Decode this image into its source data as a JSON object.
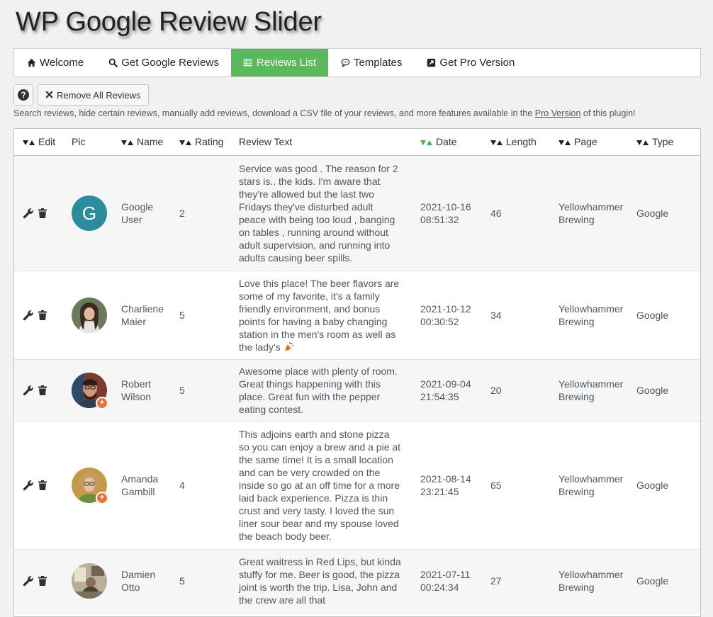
{
  "page": {
    "title": "WP Google Review Slider"
  },
  "tabs": [
    {
      "label": "Welcome",
      "icon": "home-icon",
      "active": false
    },
    {
      "label": "Get Google Reviews",
      "icon": "search-icon",
      "active": false
    },
    {
      "label": "Reviews List",
      "icon": "list-icon",
      "active": true
    },
    {
      "label": "Templates",
      "icon": "comment-icon",
      "active": false
    },
    {
      "label": "Get Pro Version",
      "icon": "external-link-icon",
      "active": false
    }
  ],
  "toolbar": {
    "help_label": "?",
    "remove_all_label": "Remove All Reviews"
  },
  "description": {
    "before": "Search reviews, hide certain reviews, manually add reviews, download a CSV file of your reviews, and more features available in the ",
    "link": "Pro Version",
    "after": " of this plugin!"
  },
  "table": {
    "columns": [
      "Edit",
      "Pic",
      "Name",
      "Rating",
      "Review Text",
      "Date",
      "Length",
      "Page",
      "Type"
    ],
    "rows": [
      {
        "name_line1": "Google",
        "name_line2": "User",
        "avatar": "letter",
        "avatar_letter": "G",
        "rating": "2",
        "text": "Service was good . The reason for 2 stars is.. the kids. I'm aware that they're allowed but the last two Fridays they've disturbed adult peace with being too loud , banging on tables , running around without adult supervision, and running into adults causing beer spills.",
        "date_line1": "2021-10-16",
        "date_line2": "08:51:32",
        "length": "46",
        "page_line1": "Yellowhammer",
        "page_line2": "Brewing",
        "type": "Google"
      },
      {
        "name_line1": "Charliene",
        "name_line2": "Maier",
        "avatar": "photo-woman-dark-hair",
        "rating": "5",
        "text": "Love this place! The beer flavors are some of my favorite, it's a family friendly environment, and bonus points for having a baby changing station in the men's room as well as the lady's",
        "date_line1": "2021-10-12",
        "date_line2": "00:30:52",
        "length": "34",
        "page_line1": "Yellowhammer",
        "page_line2": "Brewing",
        "type": "Google"
      },
      {
        "name_line1": "Robert",
        "name_line2": "Wilson",
        "avatar": "photo-man-beard",
        "rating": "5",
        "text": "Awesome place with plenty of room. Great things happening with this place. Great fun with the pepper eating contest.",
        "date_line1": "2021-09-04",
        "date_line2": "21:54:35",
        "length": "20",
        "page_line1": "Yellowhammer",
        "page_line2": "Brewing",
        "type": "Google"
      },
      {
        "name_line1": "Amanda",
        "name_line2": "Gambill",
        "avatar": "photo-woman-blonde",
        "rating": "4",
        "text": "This adjoins earth and stone pizza so you can enjoy a brew and a pie at the same time! It is a small location and can be very crowded on the inside so go at an off time for a more laid back experience. Pizza is thin crust and very tasty. I loved the sun liner sour bear and my spouse loved the beach body beer.",
        "date_line1": "2021-08-14",
        "date_line2": "23:21:45",
        "length": "65",
        "page_line1": "Yellowhammer",
        "page_line2": "Brewing",
        "type": "Google"
      },
      {
        "name_line1": "Damien",
        "name_line2": "Otto",
        "avatar": "photo-interior",
        "rating": "5",
        "text": "Great waitress in Red Lips, but kinda stuffy for me. Beer is good, the pizza joint is worth the trip. Lisa, John and the crew are all that",
        "date_line1": "2021-07-11",
        "date_line2": "00:24:34",
        "length": "27",
        "page_line1": "Yellowhammer",
        "page_line2": "Brewing",
        "type": "Google"
      }
    ]
  },
  "colors": {
    "active_tab": "#5cb85c",
    "active_sort": "#46b450",
    "avatar_letter_bg": "#2a8c9c",
    "local_guide_badge": "#e8733a"
  }
}
